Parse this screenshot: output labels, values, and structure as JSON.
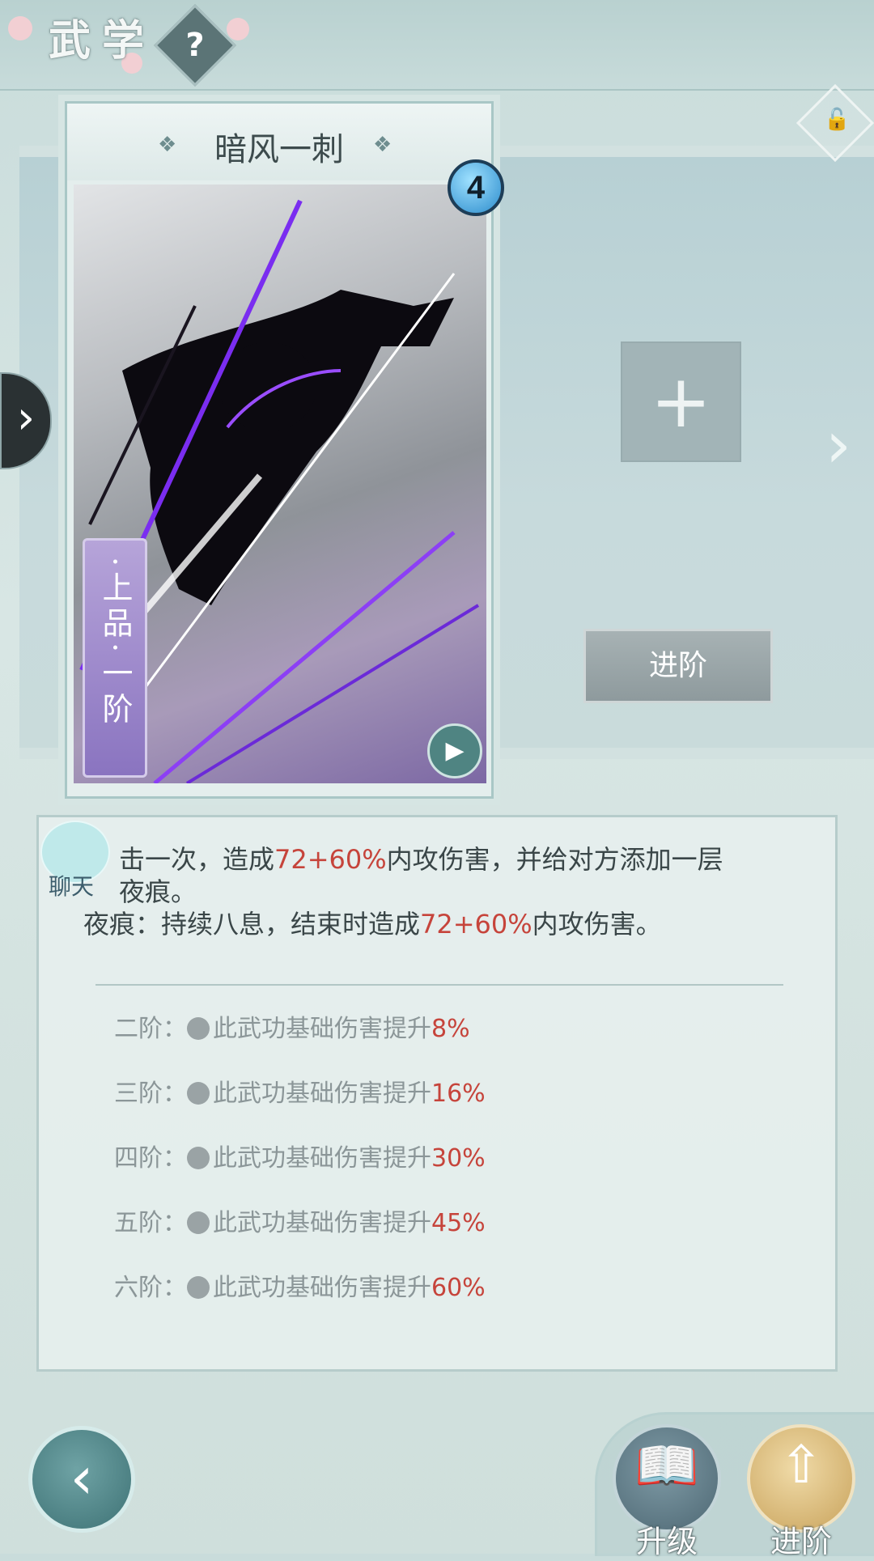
{
  "header": {
    "title": "武学",
    "help_icon": "?"
  },
  "card": {
    "name": "暗风一刺",
    "level": "4",
    "grade": "·上品·一阶"
  },
  "slot": {
    "add_icon": "+",
    "advance_label": "进阶"
  },
  "description": {
    "line1_a": "击一次，造成",
    "line1_b": "72+60%",
    "line1_c": "内攻伤害，并给对方添加一层",
    "line2": "夜痕。",
    "line3_a": "夜痕：持续八息，结束时造成",
    "line3_b": "72+60%",
    "line3_c": "内攻伤害。"
  },
  "tiers": [
    {
      "label": "二阶：",
      "text": "此武功基础伤害提升",
      "value": "8%"
    },
    {
      "label": "三阶：",
      "text": "此武功基础伤害提升",
      "value": "16%"
    },
    {
      "label": "四阶：",
      "text": "此武功基础伤害提升",
      "value": "30%"
    },
    {
      "label": "五阶：",
      "text": "此武功基础伤害提升",
      "value": "45%"
    },
    {
      "label": "六阶：",
      "text": "此武功基础伤害提升",
      "value": "60%"
    }
  ],
  "chat": {
    "label": "聊天"
  },
  "bottom": {
    "upgrade_label": "升级",
    "advance_label": "进阶"
  },
  "colors": {
    "accent_red": "#c6443b",
    "badge_blue": "#2c8ccc",
    "grade_purple": "#8a74c0"
  }
}
